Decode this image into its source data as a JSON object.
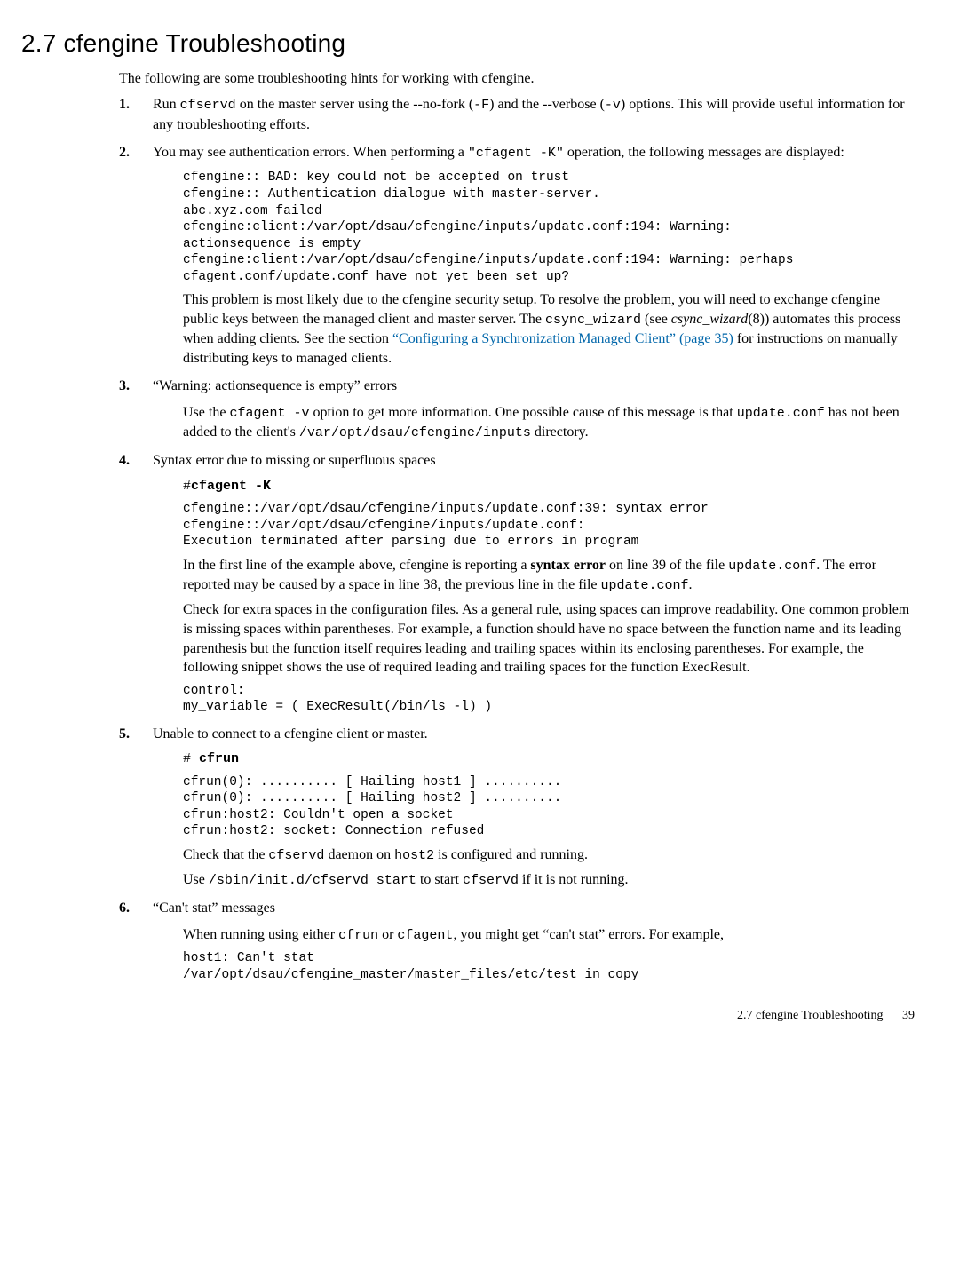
{
  "heading": "2.7 cfengine Troubleshooting",
  "intro": "The following are some troubleshooting hints for working with cfengine.",
  "item1": {
    "pre1": "Run ",
    "code1": "cfservd",
    "mid1": " on the master server using the --no-fork (",
    "code2": "-F",
    "mid2": ") and the --verbose (",
    "code3": "-v",
    "post": ") options. This will provide useful information for any troubleshooting efforts."
  },
  "item2": {
    "pre": "You may see authentication errors. When performing a ",
    "code1": "\"cfagent -K\"",
    "post": " operation, the following messages are displayed:",
    "codeblock": "cfengine:: BAD: key could not be accepted on trust\ncfengine:: Authentication dialogue with master-server.\nabc.xyz.com failed\ncfengine:client:/var/opt/dsau/cfengine/inputs/update.conf:194: Warning:\nactionsequence is empty\ncfengine:client:/var/opt/dsau/cfengine/inputs/update.conf:194: Warning: perhaps\ncfagent.conf/update.conf have not yet been set up?",
    "para2_a": "This problem is most likely due to the cfengine security setup. To resolve the problem, you will need to exchange cfengine public keys between the managed client and master server. The ",
    "para2_code": "csync_wizard",
    "para2_b": " (see ",
    "para2_ital": "csync_wizard",
    "para2_c": "(8)) automates this process when adding clients. See the section ",
    "para2_link": "“Configuring a Synchronization Managed Client” (page 35)",
    "para2_d": " for instructions on manually distributing keys to managed clients."
  },
  "item3": {
    "title": "“Warning: actionsequence is empty” errors",
    "p_a": "Use the ",
    "p_code1": "cfagent -v",
    "p_b": " option to get more information. One possible cause of this message is that ",
    "p_code2": "update.conf",
    "p_c": " has not been added to the client's ",
    "p_code3": "/var/opt/dsau/cfengine/inputs",
    "p_d": " directory."
  },
  "item4": {
    "title": "Syntax error due to missing or superfluous spaces",
    "hash": "#",
    "cmd": "cfagent -K",
    "codeblock": "cfengine::/var/opt/dsau/cfengine/inputs/update.conf:39: syntax error\ncfengine::/var/opt/dsau/cfengine/inputs/update.conf:\nExecution terminated after parsing due to errors in program",
    "p1_a": "In the first line of the example above, cfengine is reporting a ",
    "p1_bold": "syntax error",
    "p1_b": " on line 39 of the file ",
    "p1_code1": "update.conf",
    "p1_c": ". The error reported may be caused by a space in line 38, the previous line in the file ",
    "p1_code2": "update.conf",
    "p1_d": ".",
    "p2": "Check for extra spaces in the configuration files. As a general rule, using spaces can improve readability. One common problem is missing spaces within parentheses. For example, a function should have no space between the function name and its leading parenthesis but the function itself requires leading and trailing spaces within its enclosing parentheses. For example, the following snippet shows the use of required leading and trailing spaces for the function ExecResult.",
    "codeblock2": "control:\nmy_variable = ( ExecResult(/bin/ls -l) )"
  },
  "item5": {
    "title": "Unable to connect to a cfengine client or master.",
    "hash": "# ",
    "cmd": "cfrun",
    "codeblock": "cfrun(0): .......... [ Hailing host1 ] ..........\ncfrun(0): .......... [ Hailing host2 ] ..........\ncfrun:host2: Couldn't open a socket\ncfrun:host2: socket: Connection refused",
    "p1_a": "Check that the ",
    "p1_code1": "cfservd",
    "p1_b": " daemon on ",
    "p1_code2": "host2",
    "p1_c": " is configured and running.",
    "p2_a": "Use ",
    "p2_code1": "/sbin/init.d/cfservd start",
    "p2_b": " to start ",
    "p2_code2": "cfservd",
    "p2_c": " if it is not running."
  },
  "item6": {
    "title": "“Can't stat” messages",
    "p_a": "When running using either ",
    "p_code1": "cfrun",
    "p_b": " or ",
    "p_code2": "cfagent",
    "p_c": ", you might get “can't stat” errors. For example,",
    "codeblock": "host1: Can't stat\n/var/opt/dsau/cfengine_master/master_files/etc/test in copy"
  },
  "footer_text": "2.7 cfengine Troubleshooting",
  "footer_page": "39"
}
